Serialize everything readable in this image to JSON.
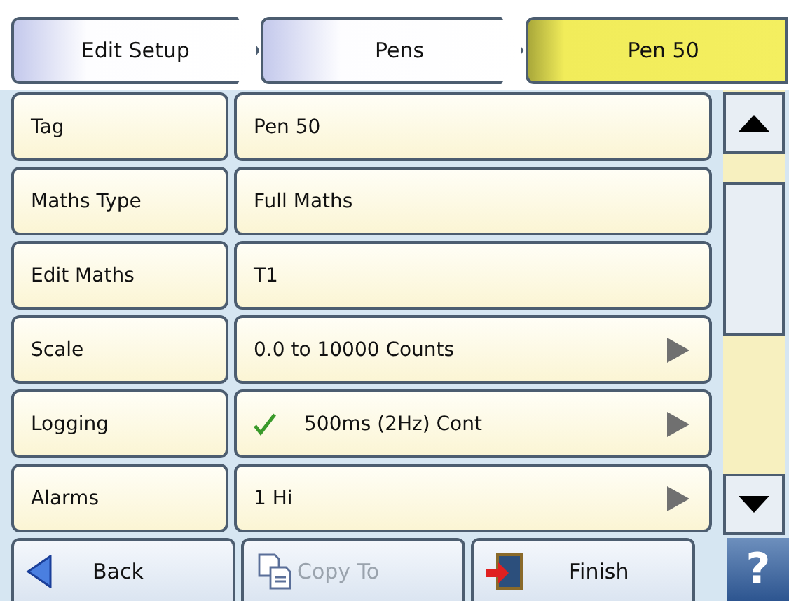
{
  "breadcrumb": [
    {
      "label": "Edit Setup",
      "selected": false
    },
    {
      "label": "Pens",
      "selected": false
    },
    {
      "label": "Pen 50",
      "selected": true
    }
  ],
  "rows": [
    {
      "label": "Tag",
      "value": "Pen 50",
      "has_arrow": false,
      "checked": false
    },
    {
      "label": "Maths Type",
      "value": "Full Maths",
      "has_arrow": false,
      "checked": false
    },
    {
      "label": "Edit Maths",
      "value": "T1",
      "has_arrow": false,
      "checked": false
    },
    {
      "label": "Scale",
      "value": "0.0 to 10000 Counts",
      "has_arrow": true,
      "checked": false
    },
    {
      "label": "Logging",
      "value": "500ms (2Hz) Cont",
      "has_arrow": true,
      "checked": true
    },
    {
      "label": "Alarms",
      "value": "1 Hi",
      "has_arrow": true,
      "checked": false
    }
  ],
  "buttons": [
    {
      "kind": "back",
      "label": "Back",
      "disabled": false
    },
    {
      "kind": "copy",
      "label": "Copy To",
      "disabled": true
    },
    {
      "kind": "finish",
      "label": "Finish",
      "disabled": false
    }
  ],
  "help": {
    "label": "?"
  }
}
